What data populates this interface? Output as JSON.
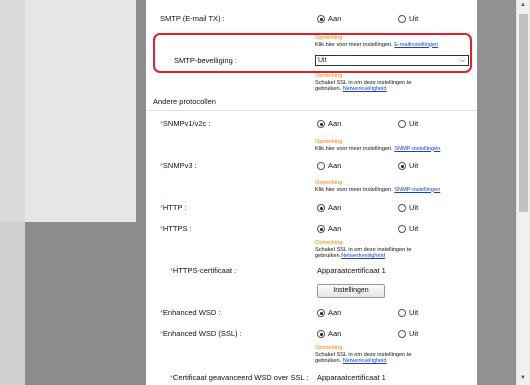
{
  "smtp": {
    "label": "SMTP (E-mail TX) :",
    "aan": "Aan",
    "uit": "Uit",
    "note_title": "Opmerking",
    "note_text": "Klik hier voor meer instellingen.",
    "note_link": "E-mailinstellingen"
  },
  "smtp_security": {
    "label": "SMTP-beveiliging :",
    "value": "Uit",
    "note_title": "Opmerking",
    "note_text1": "Schakel SSL in om deze instellingen te",
    "note_text2": "gebruiken.",
    "note_link": "Netwerkveiligheid"
  },
  "section": {
    "other_protocols": "Andere protocollen"
  },
  "required_mark": "*",
  "snmpv1": {
    "label": "SNMPv1/v2c :",
    "aan": "Aan",
    "uit": "Uit",
    "note_title": "Opmerking",
    "note_text": "Klik hier voor meer instellingen.",
    "note_link": "SNMP-instellingen"
  },
  "snmpv3": {
    "label": "SNMPv3 :",
    "aan": "Aan",
    "uit": "Uit",
    "note_title": "Opmerking",
    "note_text": "Klik hier voor meer instellingen.",
    "note_link": "SNMP-instellingen"
  },
  "http": {
    "label": "HTTP :",
    "aan": "Aan",
    "uit": "Uit"
  },
  "https": {
    "label": "HTTPS :",
    "aan": "Aan",
    "uit": "Uit",
    "note_title": "Opmerking",
    "note_text1": "Schakel SSL in om deze instellingen te",
    "note_text2": "gebruiken.",
    "note_link": "Netwerkveiligheid"
  },
  "https_cert": {
    "label": "HTTPS-certificaat :",
    "value": "Apparaatcertificaat 1",
    "button": "Instellingen"
  },
  "wsd": {
    "label": "Enhanced WSD :",
    "aan": "Aan",
    "uit": "Uit"
  },
  "wsd_ssl": {
    "label": "Enhanced WSD (SSL) :",
    "aan": "Aan",
    "uit": "Uit",
    "note_title": "Opmerking",
    "note_text1": "Schakel SSL in om deze instellingen te",
    "note_text2": "gebruiken.",
    "note_link": "Netwerkveiligheid"
  },
  "wsd_cert": {
    "label": "Certificaat geavanceerd WSD over SSL :",
    "value": "Apparaatcertificaat 1"
  },
  "colors": {
    "highlight": "#e0202a",
    "note_title": "#f08200",
    "link": "#1a3fc7",
    "required": "#e85d00"
  }
}
